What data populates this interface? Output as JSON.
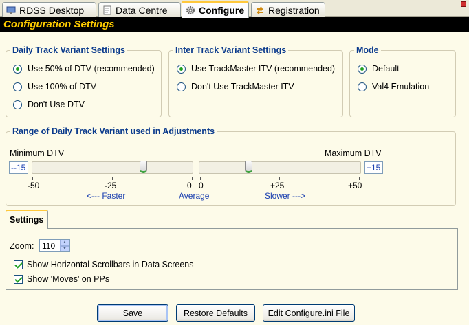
{
  "tabs": [
    {
      "label": "RDSS Desktop",
      "icon": "desktop-icon"
    },
    {
      "label": "Data Centre",
      "icon": "document-icon"
    },
    {
      "label": "Configure",
      "icon": "gear-icon",
      "active": true
    },
    {
      "label": "Registration",
      "icon": "arrows-icon"
    }
  ],
  "title": "Configuration Settings",
  "daily_group": {
    "legend": "Daily Track Variant Settings",
    "options": [
      "Use 50% of DTV (recommended)",
      "Use 100% of DTV",
      "Don't Use DTV"
    ],
    "selected": 0
  },
  "inter_group": {
    "legend": "Inter Track Variant Settings",
    "options": [
      "Use TrackMaster ITV (recommended)",
      "Don't Use TrackMaster ITV"
    ],
    "selected": 0
  },
  "mode_group": {
    "legend": "Mode",
    "options": [
      "Default",
      "Val4 Emulation"
    ],
    "selected": 0
  },
  "range_group": {
    "legend": "Range of Daily Track Variant used in Adjustments",
    "min_label": "Minimum DTV",
    "max_label": "Maximum DTV",
    "min_value": "--15",
    "max_value": "+15",
    "left_ticks": [
      "-50",
      "-25",
      "0"
    ],
    "right_ticks": [
      "0",
      "+25",
      "+50"
    ],
    "faster_label": "<--- Faster",
    "average_label": "Average",
    "slower_label": "Slower --->"
  },
  "settings_tab": {
    "label": "Settings",
    "zoom_label": "Zoom:",
    "zoom_value": "110",
    "checks": [
      {
        "label": "Show Horizontal Scrollbars in Data Screens",
        "checked": true
      },
      {
        "label": "Show 'Moves' on PPs",
        "checked": true
      }
    ]
  },
  "buttons": {
    "save": "Save",
    "restore": "Restore Defaults",
    "edit": "Edit Configure.ini File"
  }
}
